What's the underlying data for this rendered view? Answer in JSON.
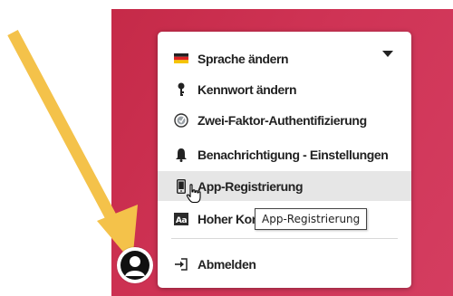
{
  "colors": {
    "background_accent": "#cf3355",
    "annotation_arrow": "#f4c24a",
    "menu_bg": "#ffffff",
    "highlight_bg": "#e6e6e6"
  },
  "menu": {
    "items": [
      {
        "label": "Sprache ändern",
        "icon": "german-flag-icon",
        "dropdown": true
      },
      {
        "label": "Kennwort ändern",
        "icon": "key-icon"
      },
      {
        "label": "Zwei-Faktor-Authentifizierung",
        "icon": "two-factor-icon"
      },
      {
        "label": "Benachrichtigung - Einstellungen",
        "icon": "bell-icon"
      },
      {
        "label": "App-Registrierung",
        "icon": "mobile-phone-icon",
        "highlighted": true
      },
      {
        "label": "Hoher Kon",
        "icon": "high-contrast-icon"
      },
      {
        "label": "Abmelden",
        "icon": "logout-icon"
      }
    ]
  },
  "tooltip": {
    "text": "App-Registrierung"
  },
  "avatar": {
    "icon": "user-avatar-icon"
  }
}
